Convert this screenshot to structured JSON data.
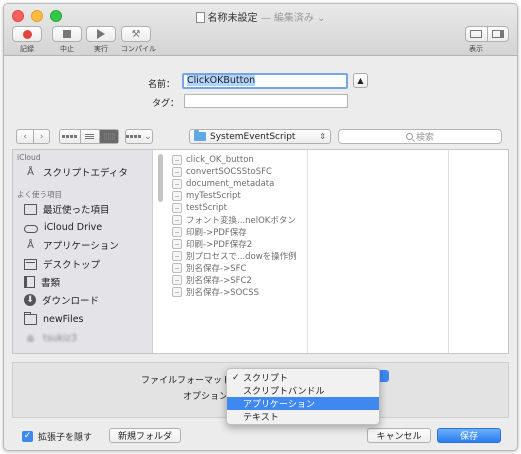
{
  "window": {
    "title": "名称未設定",
    "subtitle": "— 編集済み ⌄"
  },
  "toolbar": {
    "record": "記録",
    "stop": "中止",
    "run": "実行",
    "compile": "コンパイル",
    "view": "表示"
  },
  "save_sheet": {
    "name_label": "名前：",
    "name_value": "ClickOKButton",
    "tag_label": "タグ：",
    "tag_value": "",
    "location": "SystemEventScript",
    "search_placeholder": "検索"
  },
  "sidebar": {
    "icloud_header": "iCloud",
    "icloud_items": [
      {
        "label": "スクリプトエディタ",
        "icon": "script-editor-icon"
      }
    ],
    "favorites_header": "よく使う項目",
    "favorite_items": [
      {
        "label": "最近使った項目",
        "icon": "recents-icon"
      },
      {
        "label": "iCloud Drive",
        "icon": "cloud-icon"
      },
      {
        "label": "アプリケーション",
        "icon": "applications-icon"
      },
      {
        "label": "デスクトップ",
        "icon": "desktop-icon"
      },
      {
        "label": "書類",
        "icon": "documents-icon"
      },
      {
        "label": "ダウンロード",
        "icon": "download-icon"
      },
      {
        "label": "newFiles",
        "icon": "folder-icon"
      },
      {
        "label": "tsukiz3",
        "icon": "user-icon"
      }
    ]
  },
  "files": [
    "click_OK_button",
    "convertSOCSStoSFC",
    "document_metadata",
    "myTestScript",
    "testScript",
    "フォント変換...nelOKボタン",
    "印刷->PDF保存",
    "印刷->PDF保存2",
    "別プロセスで...dowを操作例",
    "別名保存->SFC",
    "別名保存->SFC2",
    "別名保存->SOCSS"
  ],
  "options": {
    "file_format_label": "ファイルフォーマット：",
    "options_label": "オプション："
  },
  "format_menu": {
    "items": [
      "スクリプト",
      "スクリプトバンドル",
      "アプリケーション",
      "テキスト"
    ],
    "checked_index": 0,
    "highlighted_index": 2
  },
  "bottom": {
    "hide_extension": "拡張子を隠す",
    "new_folder": "新規フォルダ",
    "cancel": "キャンセル",
    "save": "保存"
  },
  "colors": {
    "accent": "#3e88f0",
    "record": "#e0453f"
  }
}
